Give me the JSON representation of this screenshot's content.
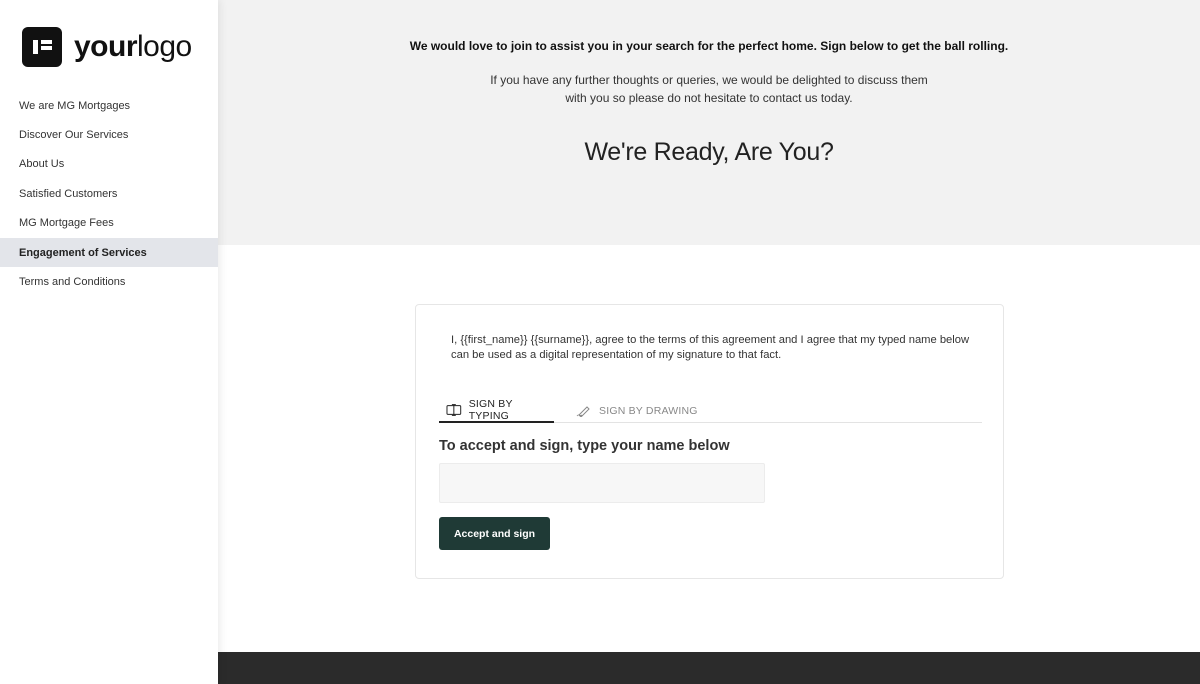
{
  "logo": {
    "brand_bold": "your",
    "brand_light": "logo"
  },
  "sidebar": {
    "items": [
      {
        "label": "We are MG Mortgages"
      },
      {
        "label": "Discover Our Services"
      },
      {
        "label": "About Us"
      },
      {
        "label": "Satisfied Customers"
      },
      {
        "label": "MG Mortgage Fees"
      },
      {
        "label": "Engagement of Services",
        "active": true
      },
      {
        "label": "Terms and Conditions"
      }
    ]
  },
  "hero": {
    "lead": "We would love to join to assist you in your search for the perfect home.  Sign below to get the ball rolling.",
    "sub_line1": "If you have any further thoughts or queries, we would be delighted to discuss them",
    "sub_line2": "with you so please do not hesitate to contact us today.",
    "title": "We're Ready, Are You?"
  },
  "signature": {
    "agreement_text": "I, {{first_name}} {{surname}}, agree to the terms of this agreement and I agree that my typed name below can be used as a digital representation of my signature to that fact.",
    "tab_typing": "SIGN BY TYPING",
    "tab_drawing": "SIGN BY DRAWING",
    "active_tab": "SIGN BY TYPING",
    "heading": "To accept and sign, type your name below",
    "name_value": "",
    "name_placeholder": "",
    "accept_label": "Accept and sign"
  },
  "colors": {
    "hero_bg": "#f2f2f2",
    "accent_button": "#1f3a36",
    "active_nav_bg": "#e3e5ea",
    "footer_bg": "#2b2b2b"
  }
}
